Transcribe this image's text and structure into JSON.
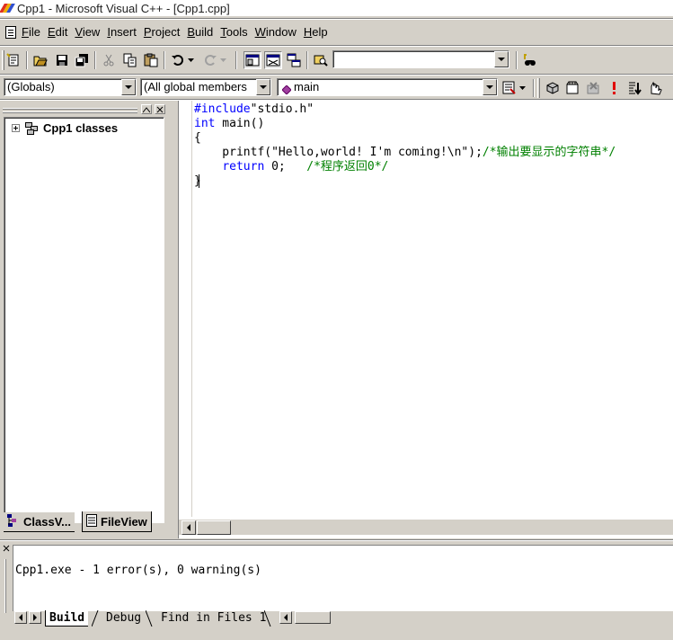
{
  "window": {
    "title": "Cpp1 - Microsoft Visual C++ - [Cpp1.cpp]"
  },
  "menu": {
    "items": [
      {
        "label": "File",
        "underline": "F"
      },
      {
        "label": "Edit",
        "underline": "E"
      },
      {
        "label": "View",
        "underline": "V"
      },
      {
        "label": "Insert",
        "underline": "I"
      },
      {
        "label": "Project",
        "underline": "P"
      },
      {
        "label": "Build",
        "underline": "B"
      },
      {
        "label": "Tools",
        "underline": "T"
      },
      {
        "label": "Window",
        "underline": "W"
      },
      {
        "label": "Help",
        "underline": "H"
      }
    ]
  },
  "toolbar_standard": {
    "buttons": [
      "new-text-file-icon",
      "open-icon",
      "save-icon",
      "save-all-icon",
      "cut-icon",
      "copy-icon",
      "paste-icon",
      "undo-icon",
      "redo-icon",
      "workspace-icon",
      "output-icon",
      "window-list-icon",
      "find-in-files-icon",
      "find-icon"
    ],
    "find_combo_value": ""
  },
  "toolbar_wizardbar": {
    "class_combo": "(Globals)",
    "filter_combo": "(All global members",
    "members_combo": "main",
    "buttons": [
      "wizard-action-icon",
      "compile-icon",
      "build-icon",
      "stop-build-icon",
      "execute-icon",
      "go-icon",
      "insert-breakpoint-icon"
    ]
  },
  "workspace": {
    "tree_root": "Cpp1 classes",
    "tabs": [
      {
        "label": "ClassV...",
        "active": true
      },
      {
        "label": "FileView",
        "active": false
      }
    ]
  },
  "editor": {
    "lines": [
      {
        "parts": [
          {
            "t": "#include",
            "c": "kw"
          },
          {
            "t": "\"stdio.h\"",
            "c": ""
          }
        ]
      },
      {
        "parts": [
          {
            "t": "int",
            "c": "kw"
          },
          {
            "t": " main()",
            "c": ""
          }
        ]
      },
      {
        "parts": [
          {
            "t": "{",
            "c": ""
          }
        ]
      },
      {
        "parts": [
          {
            "t": "    printf(\"Hello,world! I'm coming!\\n\");",
            "c": ""
          },
          {
            "t": "/*输出要显示的字符串*/",
            "c": "cm"
          }
        ]
      },
      {
        "parts": [
          {
            "t": "    ",
            "c": ""
          },
          {
            "t": "return",
            "c": "kw"
          },
          {
            "t": " 0;   ",
            "c": ""
          },
          {
            "t": "/*程序返回0*/",
            "c": "cm"
          }
        ]
      },
      {
        "parts": [
          {
            "t": "}",
            "c": ""
          }
        ]
      }
    ]
  },
  "output": {
    "text": "Cpp1.exe - 1 error(s), 0 warning(s)",
    "tabs": [
      {
        "label": "Build",
        "active": true
      },
      {
        "label": "Debug",
        "active": false
      },
      {
        "label": "Find in Files 1",
        "active": false
      }
    ]
  }
}
